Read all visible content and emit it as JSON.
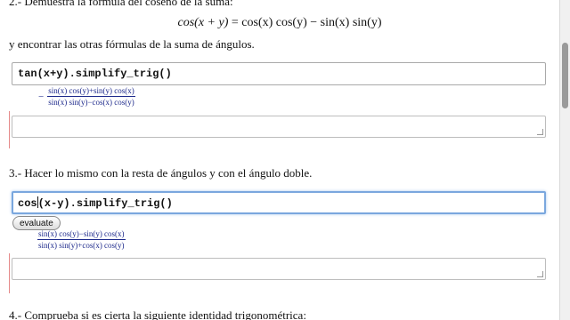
{
  "section2": {
    "heading": "2.- Demuestra la fórmula del coseno de la suma:",
    "formula_lhs": "cos(x + y)",
    "formula_rhs": "= cos(x) cos(y) − sin(x) sin(y)",
    "instruction": "y encontrar las otras fórmulas de la suma de ángulos.",
    "input_code": "tan(x+y).simplify_trig()",
    "output": {
      "sign": "−",
      "numerator": "sin(x) cos(y)+sin(y) cos(x)",
      "denominator": "sin(x) sin(y)−cos(x) cos(y)"
    }
  },
  "section3": {
    "heading": "3.- Hacer lo mismo con la resta de ángulos y con el ángulo doble.",
    "input_code_before_caret": "cos",
    "input_code_after_caret": "(x-y).simplify_trig()",
    "evaluate_label": "evaluate",
    "output": {
      "numerator": "sin(x) cos(y)−sin(y) cos(x)",
      "denominator": "sin(x) sin(y)+cos(x) cos(y)"
    }
  },
  "section4": {
    "heading": "4.- Comprueba si es cierta la siguiente identidad trigonométrica:"
  }
}
